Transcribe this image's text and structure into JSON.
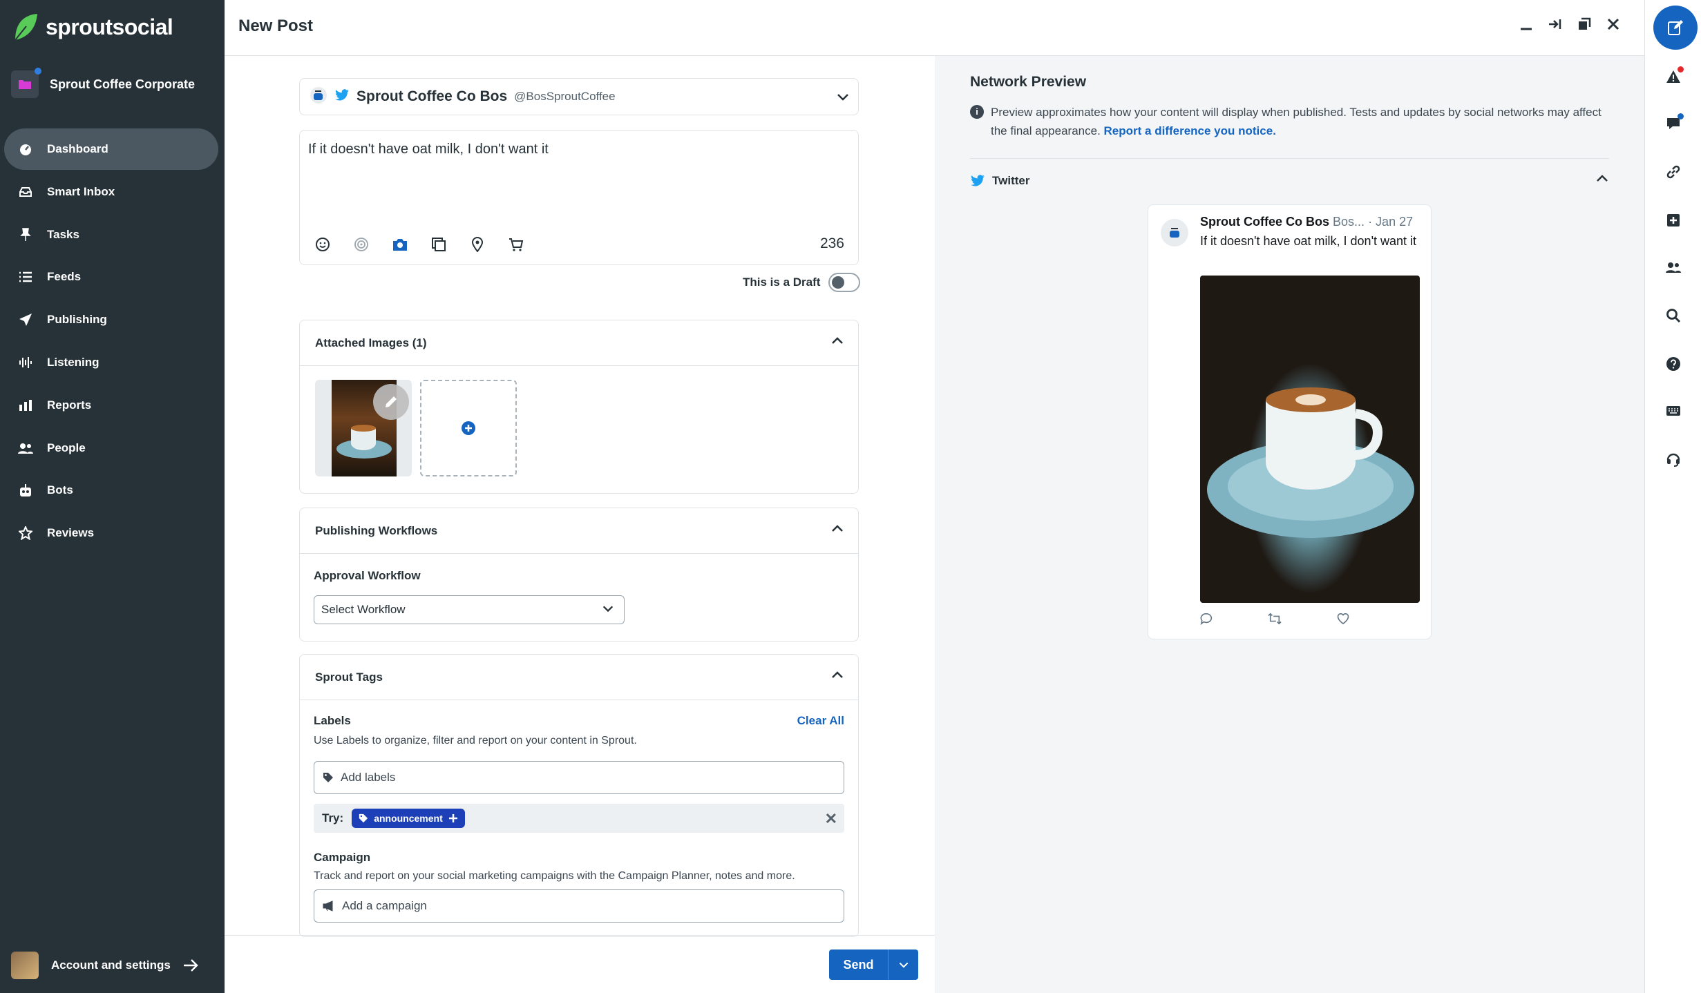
{
  "app": {
    "brand": "sproutsocial",
    "org_name": "Sprout Coffee Corporate"
  },
  "nav": {
    "items": [
      {
        "label": "Dashboard",
        "icon": "dashboard-icon",
        "active": true
      },
      {
        "label": "Smart Inbox",
        "icon": "inbox-icon"
      },
      {
        "label": "Tasks",
        "icon": "pin-icon"
      },
      {
        "label": "Feeds",
        "icon": "list-icon"
      },
      {
        "label": "Publishing",
        "icon": "send-icon"
      },
      {
        "label": "Listening",
        "icon": "waveform-icon"
      },
      {
        "label": "Reports",
        "icon": "bar-chart-icon"
      },
      {
        "label": "People",
        "icon": "people-icon"
      },
      {
        "label": "Bots",
        "icon": "bot-icon"
      },
      {
        "label": "Reviews",
        "icon": "star-icon"
      }
    ],
    "account_label": "Account and settings"
  },
  "header": {
    "title": "New Post"
  },
  "composer": {
    "profile_name": "Sprout Coffee Co Bos",
    "profile_handle": "@BosSproutCoffee",
    "message": "If it doesn't have oat milk, I don't want it",
    "char_count": "236",
    "draft_label": "This is a Draft",
    "draft_on": false
  },
  "attached_images": {
    "heading": "Attached Images (1)",
    "count": 1
  },
  "workflows": {
    "heading": "Publishing Workflows",
    "approval_label": "Approval Workflow",
    "select_value": "Select Workflow"
  },
  "tags": {
    "heading": "Sprout Tags",
    "labels_title": "Labels",
    "clear_all": "Clear All",
    "labels_desc": "Use Labels to organize, filter and report on your content in Sprout.",
    "labels_placeholder": "Add labels",
    "try_label": "Try:",
    "suggestion": "announcement",
    "campaign_title": "Campaign",
    "campaign_desc": "Track and report on your social marketing campaigns with the Campaign Planner, notes and more.",
    "campaign_placeholder": "Add a campaign"
  },
  "footer": {
    "send_label": "Send"
  },
  "preview": {
    "title": "Network Preview",
    "info_text": "Preview approximates how your content will display when published. Tests and updates by social networks may affect the final appearance.",
    "info_link": "Report a difference you notice.",
    "network": "Twitter",
    "tweet_name": "Sprout Coffee Co Bos",
    "tweet_handle": "Bos...",
    "tweet_date": "· Jan 27",
    "tweet_text": "If it doesn't have oat milk, I don't want it"
  },
  "colors": {
    "sidebar": "#273238",
    "accent": "#1565c0",
    "brand_green": "#59cb59",
    "twitter": "#1da1f2",
    "tag_pill": "#1d3fb8"
  }
}
